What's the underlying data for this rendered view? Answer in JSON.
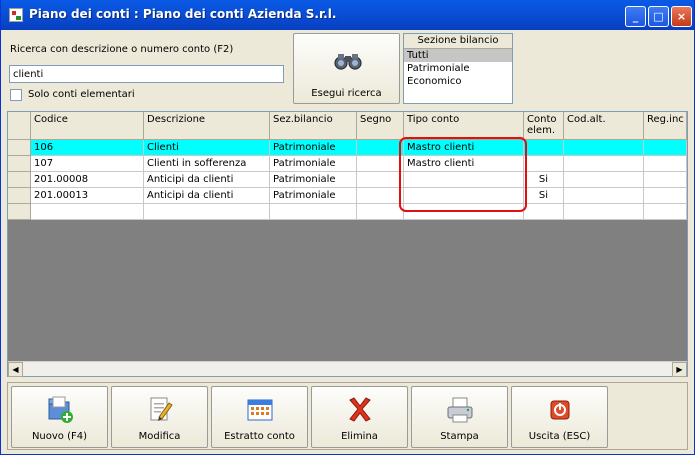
{
  "window": {
    "title": "Piano dei conti : Piano dei conti Azienda S.r.l.",
    "controls": [
      "_",
      "□",
      "×"
    ]
  },
  "search": {
    "label": "Ricerca con descrizione o numero conto (F2)",
    "value": "clienti",
    "checkbox_label": "Solo conti elementari",
    "checkbox_checked": false,
    "button_label": "Esegui ricerca"
  },
  "sezione": {
    "header": "Sezione bilancio",
    "items": [
      "Tutti",
      "Patrimoniale",
      "Economico"
    ],
    "selected": "Tutti"
  },
  "table": {
    "columns": [
      "Codice",
      "Descrizione",
      "Sez.bilancio",
      "Segno",
      "Tipo conto",
      "Conto elem.",
      "Cod.alt.",
      "Reg.inc"
    ],
    "rows": [
      [
        "106",
        "Clienti",
        "Patrimoniale",
        "",
        "Mastro clienti",
        "",
        "",
        ""
      ],
      [
        "107",
        "Clienti in sofferenza",
        "Patrimoniale",
        "",
        "Mastro clienti",
        "",
        "",
        ""
      ],
      [
        "201.00008",
        "Anticipi da clienti",
        "Patrimoniale",
        "",
        "",
        "Si",
        "",
        ""
      ],
      [
        "201.00013",
        "Anticipi da clienti",
        "Patrimoniale",
        "",
        "",
        "Si",
        "",
        ""
      ],
      [
        "",
        "",
        "",
        "",
        "",
        "",
        "",
        ""
      ]
    ],
    "highlight_color": "#00ffff"
  },
  "scroll": {
    "left_arrow": "◀",
    "right_arrow": "▶"
  },
  "toolbar": {
    "new_label": "Nuovo (F4)",
    "edit_label": "Modifica",
    "statement_label": "Estratto conto",
    "delete_label": "Elimina",
    "print_label": "Stampa",
    "exit_label": "Uscita (ESC)"
  },
  "icons": [
    "app-icon",
    "binoculars-icon",
    "new-folder-icon",
    "edit-icon",
    "calendar-icon",
    "delete-x-icon",
    "printer-icon",
    "power-icon"
  ]
}
